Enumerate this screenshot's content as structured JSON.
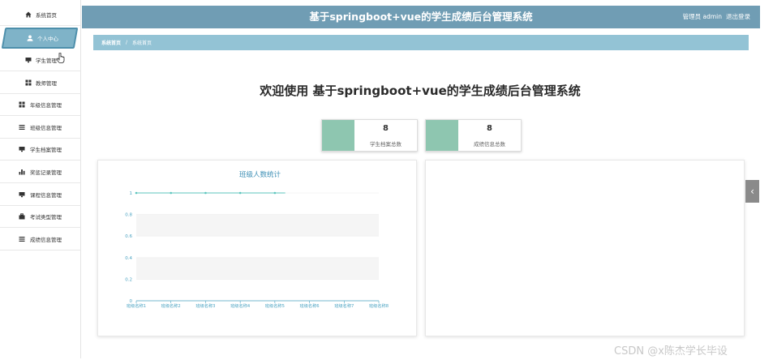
{
  "app": {
    "title": "基于springboot+vue的学生成绩后台管理系统",
    "user_label": "管理员 admin",
    "logout_label": "退出登录"
  },
  "sidebar": {
    "items": [
      {
        "label": "系统首页",
        "icon": "home-icon"
      },
      {
        "label": "个人中心",
        "icon": "user-icon",
        "active": true
      },
      {
        "label": "学生管理",
        "icon": "monitor-icon"
      },
      {
        "label": "教师管理",
        "icon": "grid-icon"
      },
      {
        "label": "年级信息管理",
        "icon": "grid-icon"
      },
      {
        "label": "班级信息管理",
        "icon": "list-icon"
      },
      {
        "label": "学生档案管理",
        "icon": "monitor-icon"
      },
      {
        "label": "奖惩记录管理",
        "icon": "bar-chart-icon"
      },
      {
        "label": "课程信息管理",
        "icon": "monitor-icon"
      },
      {
        "label": "考试类型管理",
        "icon": "briefcase-icon"
      },
      {
        "label": "成绩信息管理",
        "icon": "list-icon"
      }
    ]
  },
  "breadcrumb": {
    "items": [
      "系统首页",
      "系统首页"
    ],
    "separator": "/"
  },
  "welcome": {
    "text": "欢迎使用 基于springboot+vue的学生成绩后台管理系统"
  },
  "stats": [
    {
      "value": "8",
      "label": "学生档案总数"
    },
    {
      "value": "8",
      "label": "成绩信息总数"
    }
  ],
  "chart_data": {
    "type": "line",
    "title": "班级人数统计",
    "categories": [
      "班级名称1",
      "班级名称2",
      "班级名称3",
      "班级名称4",
      "班级名称5",
      "班级名称6",
      "班级名称7",
      "班级名称8"
    ],
    "series": [
      {
        "values": [
          1,
          1,
          1,
          1,
          1,
          null,
          null,
          null
        ]
      }
    ],
    "ylim": [
      0,
      1
    ],
    "yticks": [
      "0",
      "0.2",
      "0.4",
      "0.6",
      "0.8",
      "1"
    ],
    "grid": true,
    "xlabel": "",
    "ylabel": ""
  },
  "collapse_tab": {
    "glyph": "‹"
  },
  "watermark": {
    "text": "CSDN @x陈杰学长毕设"
  },
  "colors": {
    "header": "#709db4",
    "breadcrumb": "#93c3d5",
    "sidebar_active": "#7fb3c8",
    "stat_swatch": "#8ec6b0",
    "chart_line": "#5cc5bd",
    "chart_axis": "#4ba3c2",
    "chart_title": "#3d8fb5"
  }
}
